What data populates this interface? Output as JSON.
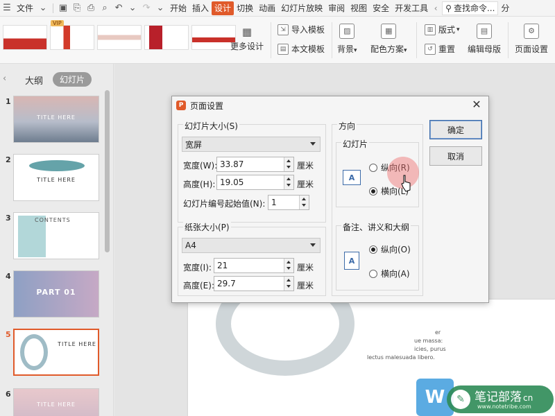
{
  "menubar": {
    "file": "文件",
    "tabs": [
      "开始",
      "插入",
      "设计",
      "切换",
      "动画",
      "幻灯片放映",
      "审阅",
      "视图",
      "安全",
      "开发工具"
    ],
    "active_tab": "设计",
    "search": "查找命令...",
    "right_text": "分"
  },
  "ribbon": {
    "vip_badge": "VIP",
    "more_design": "更多设计",
    "import_template": "导入模板",
    "this_template": "本文模板",
    "background": "背景",
    "color_scheme": "配色方案",
    "layout": "版式",
    "reset": "重置",
    "edit_master": "编辑母版",
    "page_setup": "页面设置"
  },
  "left_panel": {
    "tab_outline": "大纲",
    "tab_slides": "幻灯片",
    "slides": [
      {
        "num": "1",
        "caption": "TITLE HERE"
      },
      {
        "num": "2",
        "caption": "TITLE HERE"
      },
      {
        "num": "3",
        "caption": "CONTENTS"
      },
      {
        "num": "4",
        "caption": "PART 01"
      },
      {
        "num": "5",
        "caption": "TITLE HERE"
      },
      {
        "num": "6",
        "caption": "TITLE HERE"
      }
    ],
    "selected": "5"
  },
  "slide_canvas": {
    "text_lines": [
      "er",
      "ue massa:",
      "icies, purus",
      "lectus malesuada libero."
    ]
  },
  "dialog": {
    "title": "页面设置",
    "slide_size": {
      "label": "幻灯片大小(S)",
      "value": "宽屏",
      "width_label": "宽度(W):",
      "width": "33.87",
      "height_label": "高度(H):",
      "height": "19.05",
      "unit": "厘米",
      "start_num_label": "幻灯片编号起始值(N):",
      "start_num": "1"
    },
    "paper_size": {
      "label": "纸张大小(P)",
      "value": "A4",
      "width_label": "宽度(I):",
      "width": "21",
      "height_label": "高度(E):",
      "height": "29.7",
      "unit": "厘米"
    },
    "orientation": {
      "label": "方向",
      "slides_label": "幻灯片",
      "portrait": "纵向(R)",
      "landscape": "横向(L)",
      "slides_selected": "landscape",
      "notes_label": "备注、讲义和大纲",
      "notes_portrait": "纵向(O)",
      "notes_landscape": "横向(A)",
      "notes_selected": "portrait",
      "icon_letter": "A"
    },
    "ok": "确定",
    "cancel": "取消"
  },
  "watermark": {
    "w": "W",
    "name": "笔记部落",
    "suffix": "cn",
    "url": "www.notetribe.com"
  }
}
